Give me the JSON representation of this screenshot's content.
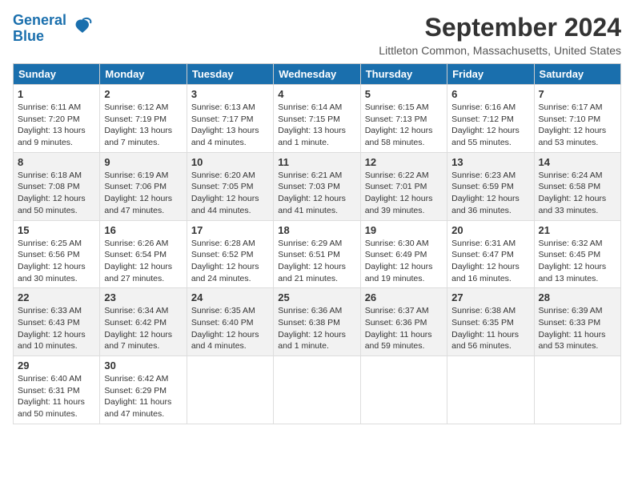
{
  "header": {
    "logo_line1": "General",
    "logo_line2": "Blue",
    "title": "September 2024",
    "subtitle": "Littleton Common, Massachusetts, United States"
  },
  "days_of_week": [
    "Sunday",
    "Monday",
    "Tuesday",
    "Wednesday",
    "Thursday",
    "Friday",
    "Saturday"
  ],
  "weeks": [
    [
      {
        "day": 1,
        "lines": [
          "Sunrise: 6:11 AM",
          "Sunset: 7:20 PM",
          "Daylight: 13 hours",
          "and 9 minutes."
        ]
      },
      {
        "day": 2,
        "lines": [
          "Sunrise: 6:12 AM",
          "Sunset: 7:19 PM",
          "Daylight: 13 hours",
          "and 7 minutes."
        ]
      },
      {
        "day": 3,
        "lines": [
          "Sunrise: 6:13 AM",
          "Sunset: 7:17 PM",
          "Daylight: 13 hours",
          "and 4 minutes."
        ]
      },
      {
        "day": 4,
        "lines": [
          "Sunrise: 6:14 AM",
          "Sunset: 7:15 PM",
          "Daylight: 13 hours",
          "and 1 minute."
        ]
      },
      {
        "day": 5,
        "lines": [
          "Sunrise: 6:15 AM",
          "Sunset: 7:13 PM",
          "Daylight: 12 hours",
          "and 58 minutes."
        ]
      },
      {
        "day": 6,
        "lines": [
          "Sunrise: 6:16 AM",
          "Sunset: 7:12 PM",
          "Daylight: 12 hours",
          "and 55 minutes."
        ]
      },
      {
        "day": 7,
        "lines": [
          "Sunrise: 6:17 AM",
          "Sunset: 7:10 PM",
          "Daylight: 12 hours",
          "and 53 minutes."
        ]
      }
    ],
    [
      {
        "day": 8,
        "lines": [
          "Sunrise: 6:18 AM",
          "Sunset: 7:08 PM",
          "Daylight: 12 hours",
          "and 50 minutes."
        ]
      },
      {
        "day": 9,
        "lines": [
          "Sunrise: 6:19 AM",
          "Sunset: 7:06 PM",
          "Daylight: 12 hours",
          "and 47 minutes."
        ]
      },
      {
        "day": 10,
        "lines": [
          "Sunrise: 6:20 AM",
          "Sunset: 7:05 PM",
          "Daylight: 12 hours",
          "and 44 minutes."
        ]
      },
      {
        "day": 11,
        "lines": [
          "Sunrise: 6:21 AM",
          "Sunset: 7:03 PM",
          "Daylight: 12 hours",
          "and 41 minutes."
        ]
      },
      {
        "day": 12,
        "lines": [
          "Sunrise: 6:22 AM",
          "Sunset: 7:01 PM",
          "Daylight: 12 hours",
          "and 39 minutes."
        ]
      },
      {
        "day": 13,
        "lines": [
          "Sunrise: 6:23 AM",
          "Sunset: 6:59 PM",
          "Daylight: 12 hours",
          "and 36 minutes."
        ]
      },
      {
        "day": 14,
        "lines": [
          "Sunrise: 6:24 AM",
          "Sunset: 6:58 PM",
          "Daylight: 12 hours",
          "and 33 minutes."
        ]
      }
    ],
    [
      {
        "day": 15,
        "lines": [
          "Sunrise: 6:25 AM",
          "Sunset: 6:56 PM",
          "Daylight: 12 hours",
          "and 30 minutes."
        ]
      },
      {
        "day": 16,
        "lines": [
          "Sunrise: 6:26 AM",
          "Sunset: 6:54 PM",
          "Daylight: 12 hours",
          "and 27 minutes."
        ]
      },
      {
        "day": 17,
        "lines": [
          "Sunrise: 6:28 AM",
          "Sunset: 6:52 PM",
          "Daylight: 12 hours",
          "and 24 minutes."
        ]
      },
      {
        "day": 18,
        "lines": [
          "Sunrise: 6:29 AM",
          "Sunset: 6:51 PM",
          "Daylight: 12 hours",
          "and 21 minutes."
        ]
      },
      {
        "day": 19,
        "lines": [
          "Sunrise: 6:30 AM",
          "Sunset: 6:49 PM",
          "Daylight: 12 hours",
          "and 19 minutes."
        ]
      },
      {
        "day": 20,
        "lines": [
          "Sunrise: 6:31 AM",
          "Sunset: 6:47 PM",
          "Daylight: 12 hours",
          "and 16 minutes."
        ]
      },
      {
        "day": 21,
        "lines": [
          "Sunrise: 6:32 AM",
          "Sunset: 6:45 PM",
          "Daylight: 12 hours",
          "and 13 minutes."
        ]
      }
    ],
    [
      {
        "day": 22,
        "lines": [
          "Sunrise: 6:33 AM",
          "Sunset: 6:43 PM",
          "Daylight: 12 hours",
          "and 10 minutes."
        ]
      },
      {
        "day": 23,
        "lines": [
          "Sunrise: 6:34 AM",
          "Sunset: 6:42 PM",
          "Daylight: 12 hours",
          "and 7 minutes."
        ]
      },
      {
        "day": 24,
        "lines": [
          "Sunrise: 6:35 AM",
          "Sunset: 6:40 PM",
          "Daylight: 12 hours",
          "and 4 minutes."
        ]
      },
      {
        "day": 25,
        "lines": [
          "Sunrise: 6:36 AM",
          "Sunset: 6:38 PM",
          "Daylight: 12 hours",
          "and 1 minute."
        ]
      },
      {
        "day": 26,
        "lines": [
          "Sunrise: 6:37 AM",
          "Sunset: 6:36 PM",
          "Daylight: 11 hours",
          "and 59 minutes."
        ]
      },
      {
        "day": 27,
        "lines": [
          "Sunrise: 6:38 AM",
          "Sunset: 6:35 PM",
          "Daylight: 11 hours",
          "and 56 minutes."
        ]
      },
      {
        "day": 28,
        "lines": [
          "Sunrise: 6:39 AM",
          "Sunset: 6:33 PM",
          "Daylight: 11 hours",
          "and 53 minutes."
        ]
      }
    ],
    [
      {
        "day": 29,
        "lines": [
          "Sunrise: 6:40 AM",
          "Sunset: 6:31 PM",
          "Daylight: 11 hours",
          "and 50 minutes."
        ]
      },
      {
        "day": 30,
        "lines": [
          "Sunrise: 6:42 AM",
          "Sunset: 6:29 PM",
          "Daylight: 11 hours",
          "and 47 minutes."
        ]
      },
      null,
      null,
      null,
      null,
      null
    ]
  ]
}
